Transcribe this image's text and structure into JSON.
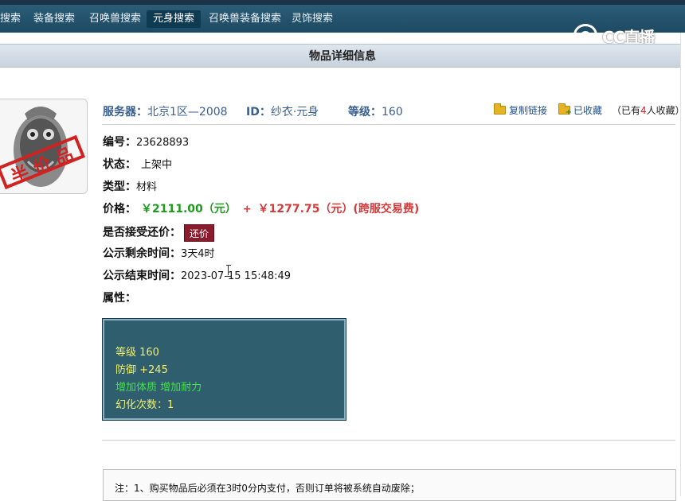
{
  "nav": {
    "items": [
      {
        "label": "搜索",
        "active": false
      },
      {
        "label": "装备搜索",
        "active": false
      },
      {
        "label": "召唤兽搜索",
        "active": false
      },
      {
        "label": "元身搜索",
        "active": true
      },
      {
        "label": "召唤兽装备搜索",
        "active": false
      },
      {
        "label": "灵饰搜索",
        "active": false
      }
    ]
  },
  "watermark": {
    "text": "CC直播",
    "icon": "cc-logo-icon"
  },
  "page_title": "物品详细信息",
  "item_image": {
    "stamp_text": "半价品",
    "icon": "item-artifact-image"
  },
  "header": {
    "server_label": "服务器：",
    "server_value": "北京1区—2008",
    "id_label": "ID：",
    "id_value": "纱衣·元身",
    "level_label": "等级：",
    "level_value": "160",
    "copy_link": "复制链接",
    "favorited": "已收藏",
    "fav_count_prefix": "（已有",
    "fav_count_num": "4",
    "fav_count_suffix": "人收藏）"
  },
  "details": {
    "serial_label": "编号：",
    "serial_value": "23628893",
    "status_label": "状态：",
    "status_value": "上架中",
    "type_label": "类型：",
    "type_value": "材料",
    "price_label": "价格：",
    "price_main": "￥2111.00（元）",
    "price_plus": "+",
    "price_fee": "￥1277.75（元）(跨服交易费)",
    "counter_label": "是否接受还价：",
    "counter_button": "还价",
    "remaining_label": "公示剩余时间：",
    "remaining_value": "3天4时",
    "end_label": "公示结束时间：",
    "end_value": "2023-07-15 15:48:49",
    "attr_label": "属性："
  },
  "attributes": {
    "level": "等级 160",
    "defense": "防御 +245",
    "bonus": "增加体质 增加耐力",
    "transform": "幻化次数：1"
  },
  "notice": "注：1、购买物品后必须在3时0分内支付，否则订单将被系统自动废除；",
  "colors": {
    "nav_bg": "#1d4a63",
    "price_green": "#1c9a1c",
    "price_red": "#d23a3a",
    "counter_btn": "#8b1c2e",
    "attr_bg": "#2f5e6e",
    "attr_yellow": "#f0ef70",
    "attr_green": "#41e441"
  }
}
